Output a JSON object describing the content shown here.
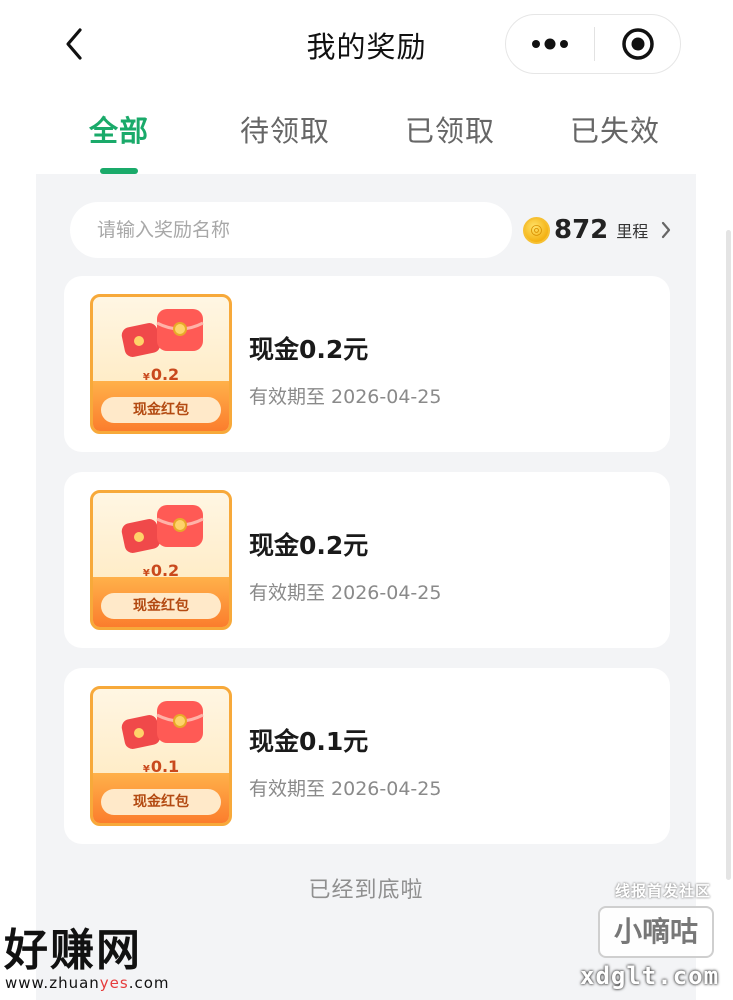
{
  "header": {
    "title": "我的奖励",
    "back_icon": "chevron-left-icon",
    "more_icon": "more-dots-icon",
    "close_icon": "target-close-icon"
  },
  "tabs": [
    {
      "label": "全部",
      "active": true
    },
    {
      "label": "待领取",
      "active": false
    },
    {
      "label": "已领取",
      "active": false
    },
    {
      "label": "已失效",
      "active": false
    }
  ],
  "search": {
    "placeholder": "请输入奖励名称",
    "value": ""
  },
  "mileage": {
    "value": "872",
    "unit": "里程",
    "icon": "coin-icon"
  },
  "rewards": [
    {
      "title": "现金0.2元",
      "expiry": "有效期至 2026-04-25",
      "coupon_amount": "0.2",
      "coupon_yen": "¥",
      "coupon_tag": "现金红包"
    },
    {
      "title": "现金0.2元",
      "expiry": "有效期至 2026-04-25",
      "coupon_amount": "0.2",
      "coupon_yen": "¥",
      "coupon_tag": "现金红包"
    },
    {
      "title": "现金0.1元",
      "expiry": "有效期至 2026-04-25",
      "coupon_amount": "0.1",
      "coupon_yen": "¥",
      "coupon_tag": "现金红包"
    }
  ],
  "footer": {
    "end_tip": "已经到底啦"
  },
  "watermarks": {
    "left_big": "好赚网",
    "left_small_a": "www.zhuan",
    "left_small_b": "yes",
    "left_small_c": ".com",
    "right_line1": "线报首发社区",
    "right_box": "小嘀咕",
    "right_line3": "xdglt.com"
  },
  "colors": {
    "accent": "#1aaa6a",
    "coupon_orange": "#fb7d2d",
    "panel_bg": "#f3f4f6"
  }
}
